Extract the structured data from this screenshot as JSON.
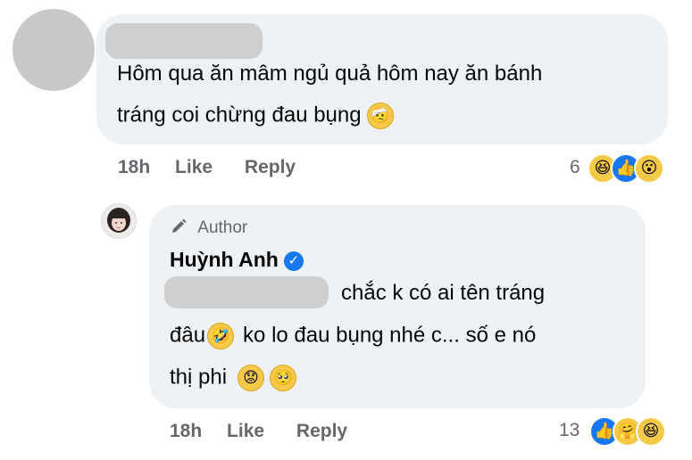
{
  "comment1": {
    "author_name": "",
    "text_line1": "Hôm qua ăn mâm ngủ quả hôm nay ăn bánh",
    "text_line2": "tráng coi chừng đau bụng",
    "inline_emoji": "bandaged-face",
    "time": "18h",
    "like_label": "Like",
    "reply_label": "Reply",
    "reaction_count": "6",
    "reactions": [
      "haha",
      "like",
      "wow"
    ]
  },
  "reply": {
    "badge_label": "Author",
    "author_name": "Huỳnh Anh",
    "verified": true,
    "mention": "",
    "text_line1": "chắc k có ai tên tráng",
    "text_line2_a": "đâu",
    "text_line2_b": "ko lo đau bụng nhé c... số e nó",
    "text_line3": "thị phi",
    "inline_emojis": [
      "rolling-laughing",
      "worried-face",
      "pleading-face"
    ],
    "time": "18h",
    "like_label": "Like",
    "reply_label": "Reply",
    "reaction_count": "13",
    "reactions": [
      "like",
      "care",
      "haha"
    ]
  },
  "colors": {
    "bubble": "#eff2f5",
    "meta": "#65676b",
    "like_blue": "#1877f2",
    "emoji_yellow": "#f7c948"
  }
}
